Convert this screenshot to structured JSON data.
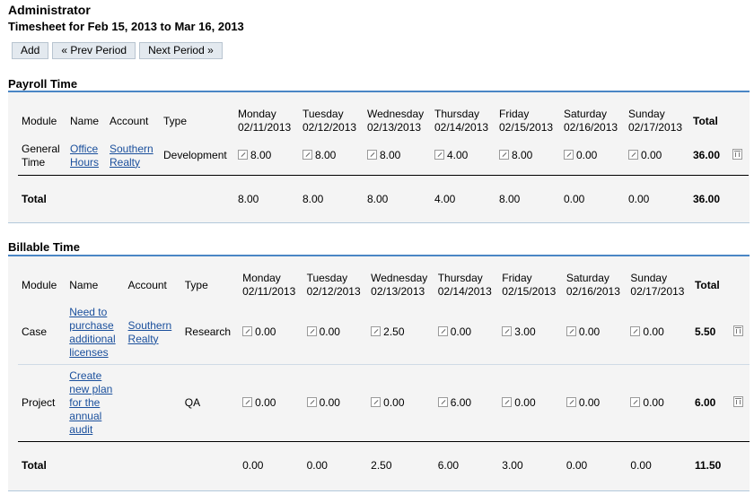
{
  "header": {
    "title": "Administrator",
    "subtitle": "Timesheet for Feb 15, 2013 to Mar 16, 2013"
  },
  "toolbar": {
    "add_label": "Add",
    "prev_label": "« Prev Period",
    "next_label": "Next Period »"
  },
  "days": [
    {
      "name": "Monday",
      "date": "02/11/2013"
    },
    {
      "name": "Tuesday",
      "date": "02/12/2013"
    },
    {
      "name": "Wednesday",
      "date": "02/13/2013"
    },
    {
      "name": "Thursday",
      "date": "02/14/2013"
    },
    {
      "name": "Friday",
      "date": "02/15/2013"
    },
    {
      "name": "Saturday",
      "date": "02/16/2013"
    },
    {
      "name": "Sunday",
      "date": "02/17/2013"
    }
  ],
  "columns": {
    "module": "Module",
    "name": "Name",
    "account": "Account",
    "type": "Type",
    "total": "Total"
  },
  "payroll": {
    "title": "Payroll Time",
    "rows": [
      {
        "module": "General Time",
        "name": "Office Hours",
        "account": "Southern Realty",
        "type": "Development",
        "hours": [
          "8.00",
          "8.00",
          "8.00",
          "4.00",
          "8.00",
          "0.00",
          "0.00"
        ],
        "total": "36.00"
      }
    ],
    "totals": {
      "label": "Total",
      "hours": [
        "8.00",
        "8.00",
        "8.00",
        "4.00",
        "8.00",
        "0.00",
        "0.00"
      ],
      "total": "36.00"
    }
  },
  "billable": {
    "title": "Billable Time",
    "rows": [
      {
        "module": "Case",
        "name": "Need to purchase additional licenses",
        "account": "Southern Realty",
        "type": "Research",
        "hours": [
          "0.00",
          "0.00",
          "2.50",
          "0.00",
          "3.00",
          "0.00",
          "0.00"
        ],
        "total": "5.50"
      },
      {
        "module": "Project",
        "name": "Create new plan for the annual audit",
        "account": "",
        "type": "QA",
        "hours": [
          "0.00",
          "0.00",
          "0.00",
          "6.00",
          "0.00",
          "0.00",
          "0.00"
        ],
        "total": "6.00"
      }
    ],
    "totals": {
      "label": "Total",
      "hours": [
        "0.00",
        "0.00",
        "2.50",
        "6.00",
        "3.00",
        "0.00",
        "0.00"
      ],
      "total": "11.50"
    }
  },
  "icons": {
    "edit": "pencil-edit-icon",
    "delete": "trash-icon"
  }
}
